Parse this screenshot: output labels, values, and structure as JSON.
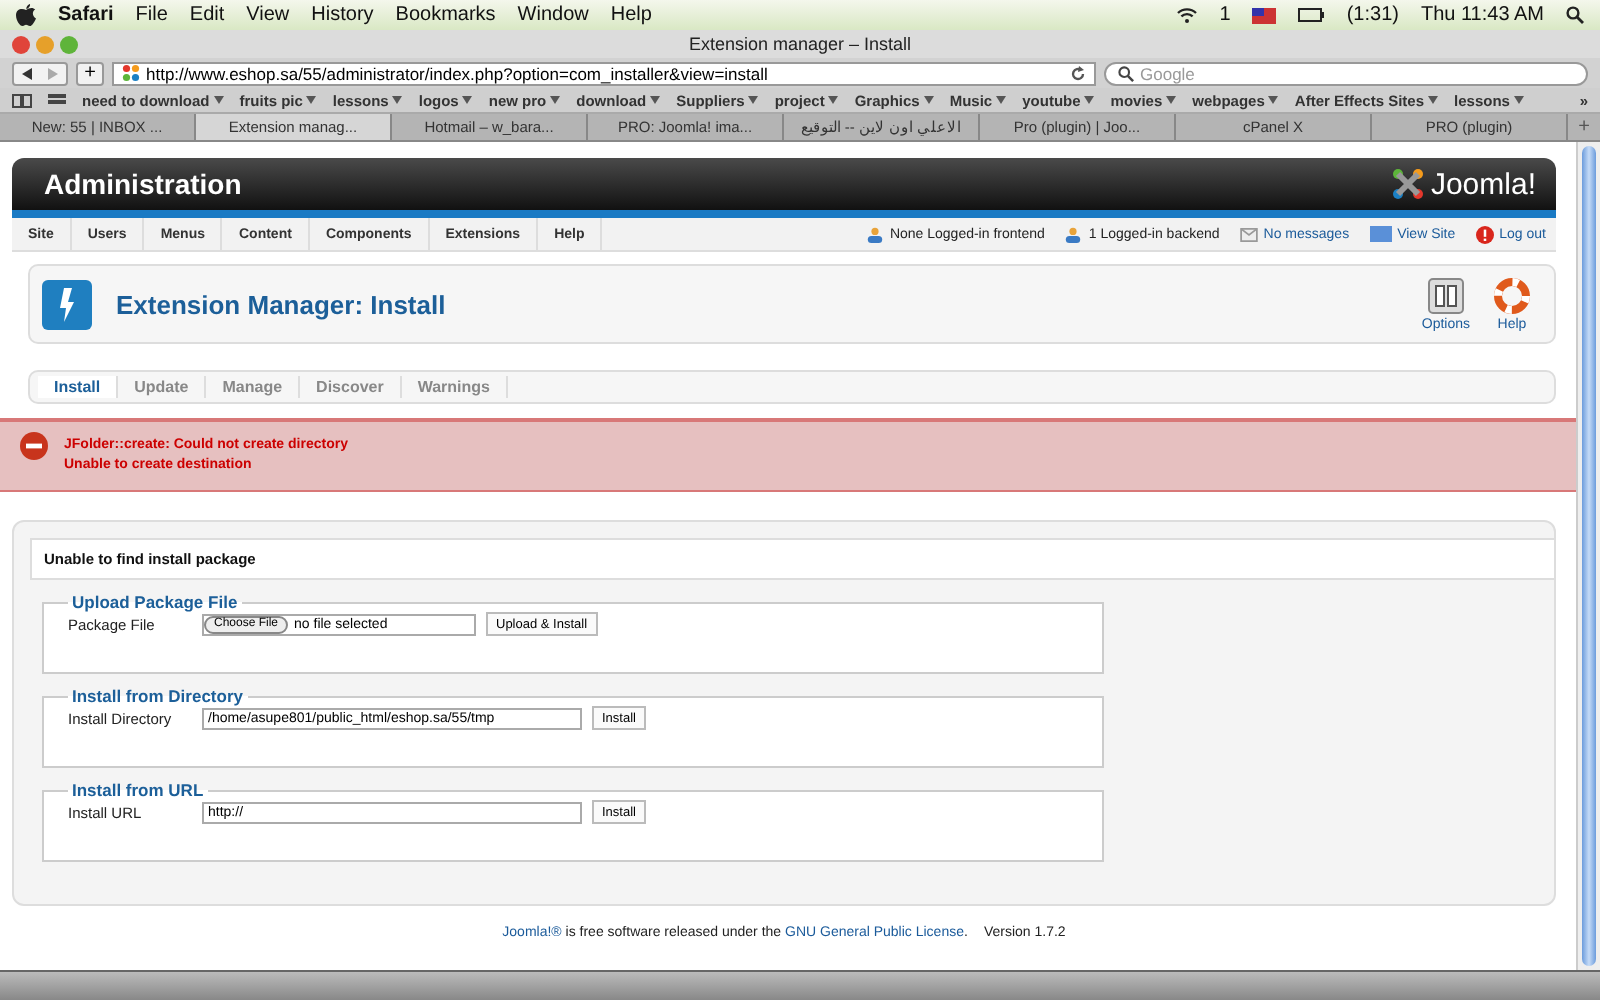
{
  "menubar": {
    "app": "Safari",
    "menus": [
      "File",
      "Edit",
      "View",
      "History",
      "Bookmarks",
      "Window",
      "Help"
    ],
    "badge": "1",
    "battery": "(1:31)",
    "clock": "Thu 11:43 AM"
  },
  "window": {
    "title": "Extension manager – Install"
  },
  "toolbar": {
    "add": "+",
    "url": "http://www.eshop.sa/55/administrator/index.php?option=com_installer&view=install",
    "search_placeholder": "Google"
  },
  "bookmarks": {
    "items": [
      "need to download",
      "fruits pic",
      "lessons",
      "logos",
      "new pro",
      "download",
      "Suppliers",
      "project",
      "Graphics",
      "Music",
      "youtube",
      "movies",
      "webpages",
      "After Effects Sites",
      "lessons"
    ],
    "more": "»"
  },
  "tabs": [
    {
      "label": "New: 55 | INBOX ...",
      "selected": false
    },
    {
      "label": "Extension manag...",
      "selected": true
    },
    {
      "label": "Hotmail – w_bara...",
      "selected": false
    },
    {
      "label": "PRO: Joomla! ima...",
      "selected": false
    },
    {
      "label": "الاعلي اون لاين -- التوقيع",
      "selected": false
    },
    {
      "label": "Pro (plugin) | Joo...",
      "selected": false
    },
    {
      "label": "cPanel X",
      "selected": false
    },
    {
      "label": "PRO (plugin)",
      "selected": false
    }
  ],
  "new_tab": "+",
  "admin": {
    "title": "Administration",
    "logo": "Joomla!",
    "menu": [
      "Site",
      "Users",
      "Menus",
      "Content",
      "Components",
      "Extensions",
      "Help"
    ],
    "status": [
      {
        "kind": "users",
        "label": "None Logged-in frontend"
      },
      {
        "kind": "users",
        "label": "1 Logged-in backend"
      },
      {
        "kind": "messages",
        "label": "No messages"
      },
      {
        "kind": "site",
        "label": "View Site"
      },
      {
        "kind": "logout",
        "label": "Log out"
      }
    ],
    "page_title": "Extension Manager: Install",
    "actions": [
      {
        "kind": "options",
        "label": "Options"
      },
      {
        "kind": "help",
        "label": "Help"
      }
    ],
    "subtabs": [
      {
        "label": "Install",
        "selected": true
      },
      {
        "label": "Update",
        "selected": false
      },
      {
        "label": "Manage",
        "selected": false
      },
      {
        "label": "Discover",
        "selected": false
      },
      {
        "label": "Warnings",
        "selected": false
      }
    ],
    "errors": [
      "JFolder::create: Could not create directory",
      "Unable to create destination"
    ],
    "notice": "Unable to find install package",
    "sections": [
      {
        "kind": "file",
        "legend": "Upload Package File",
        "label": "Package File",
        "choose": "Choose File",
        "value": "no file selected",
        "button": "Upload & Install"
      },
      {
        "kind": "text",
        "legend": "Install from Directory",
        "label": "Install Directory",
        "value": "/home/asupe801/public_html/eshop.sa/55/tmp",
        "button": "Install"
      },
      {
        "kind": "text",
        "legend": "Install from URL",
        "label": "Install URL",
        "value": "http://",
        "button": "Install"
      }
    ],
    "footer": {
      "link": "Joomla!®",
      "text": " is free software released under the ",
      "license": "GNU General Public License",
      "end": ".",
      "version": "Version 1.7.2"
    }
  }
}
